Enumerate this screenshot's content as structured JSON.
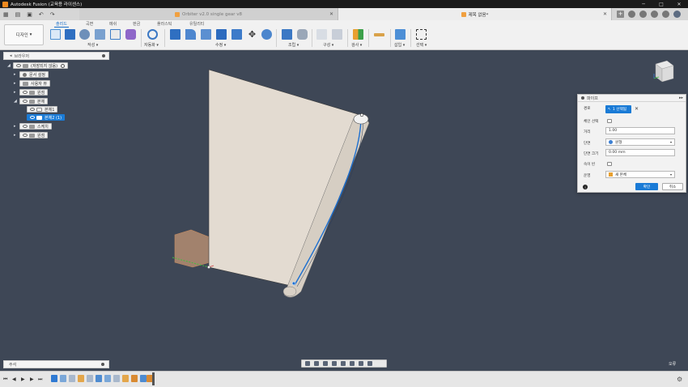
{
  "app": {
    "window_title": "Autodesk Fusion (교육용 라이센스)",
    "window_controls": [
      "─",
      "□",
      "✕"
    ]
  },
  "doc_tabs": {
    "inactive": "Orbiter v2.0 single gear v8",
    "active": "제목 없음*"
  },
  "toolbar": {
    "workspace": "디자인",
    "tabs": [
      "솔리드",
      "곡면",
      "메쉬",
      "판금",
      "플라스틱",
      "유틸리티"
    ],
    "groups": [
      "작성",
      "자동화",
      "수정",
      "조립",
      "구성",
      "검사",
      "삽입",
      "선택"
    ]
  },
  "browser": {
    "title": "브라우저",
    "root": "(저장되지 않음)",
    "items": [
      {
        "label": "문서 설정",
        "selected": false
      },
      {
        "label": "사용자 뷰",
        "selected": false
      },
      {
        "label": "원점",
        "selected": false
      },
      {
        "label": "본체",
        "selected": false
      },
      {
        "label": "본체1",
        "selected": false
      },
      {
        "label": "본체2 (1)",
        "selected": true
      },
      {
        "label": "스케치",
        "selected": false
      },
      {
        "label": "원점",
        "selected": false
      }
    ]
  },
  "panel": {
    "title": "파이프",
    "path_label": "경로",
    "path_selected": "1 선택됨",
    "chain_label": "체인 선택",
    "distance_label": "거리",
    "distance_value": "1.00",
    "section_label": "단면",
    "section_value": "원형",
    "section_size_label": "단면 크기",
    "section_size_value": "0.00 mm",
    "hollow_label": "속이 빈",
    "operation_label": "운영",
    "operation_value": "새 본체",
    "ok": "확인",
    "cancel": "취소"
  },
  "comments": {
    "title": "주석"
  },
  "status": {
    "errors": "오류"
  },
  "colors": {
    "viewport": "#3e4756",
    "accent": "#1a7bd6",
    "brand": "#f08a1f",
    "body": "#e6ddd2"
  }
}
